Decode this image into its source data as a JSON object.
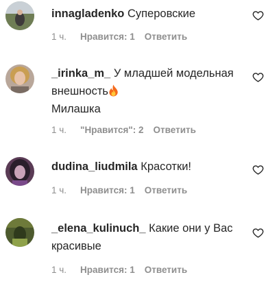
{
  "comments": [
    {
      "username": "innagladenko",
      "text": "Суперовские",
      "time": "1 ч.",
      "likes": "Нравится: 1",
      "reply": "Ответить",
      "avatar_icon": "user-photo-avatar"
    },
    {
      "username": "_irinka_m_",
      "text": "У младшей модельная внешность",
      "text_line3": "Милашка",
      "emoji": "fire-emoji",
      "time": "1 ч.",
      "likes": "\"Нравится\": 2",
      "reply": "Ответить",
      "avatar_icon": "user-photo-avatar"
    },
    {
      "username": "dudina_liudmila",
      "text": "Красотки!",
      "time": "1 ч.",
      "likes": "Нравится: 1",
      "reply": "Ответить",
      "avatar_icon": "user-photo-avatar"
    },
    {
      "username": "_elena_kulinuch_",
      "text": "Какие они у Вас красивые",
      "time": "1 ч.",
      "likes": "Нравится: 1",
      "reply": "Ответить",
      "avatar_icon": "user-photo-avatar"
    }
  ],
  "icons": {
    "like": "heart-outline-icon"
  },
  "colors": {
    "text": "#262626",
    "secondary": "#8e8e8e",
    "background": "#ffffff"
  }
}
